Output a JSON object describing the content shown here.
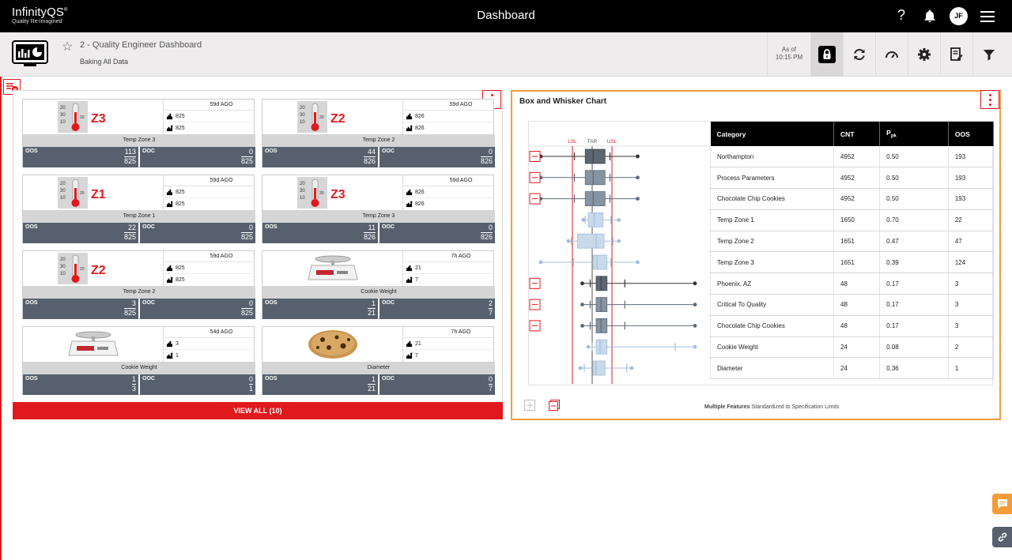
{
  "topbar": {
    "brand": "InfinityQS",
    "brand_reg": "®",
    "tagline": "Quality Re-imagined",
    "title": "Dashboard",
    "help": "?",
    "user_initials": "JF"
  },
  "subheader": {
    "dashboard_name": "2 - Quality Engineer Dashboard",
    "data_scope": "Baking All Data",
    "as_of_label": "As of",
    "as_of_time": "10:15 PM"
  },
  "cards": [
    {
      "zone": "Z3",
      "ago": "59d AGO",
      "count_a": "825",
      "count_b": "825",
      "name": "Temp Zone 3",
      "oos_label": "OOS",
      "oos_num": "113",
      "oos_den": "825",
      "ooc_label": "OOC",
      "ooc_num": "0",
      "ooc_den": "825"
    },
    {
      "zone": "Z2",
      "ago": "59d AGO",
      "count_a": "826",
      "count_b": "826",
      "name": "Temp Zone 2",
      "oos_label": "OOS",
      "oos_num": "44",
      "oos_den": "826",
      "ooc_label": "OOC",
      "ooc_num": "0",
      "ooc_den": "826"
    },
    {
      "zone": "Z1",
      "ago": "59d AGO",
      "count_a": "825",
      "count_b": "825",
      "name": "Temp Zone 1",
      "oos_label": "OOS",
      "oos_num": "22",
      "oos_den": "825",
      "ooc_label": "OOC",
      "ooc_num": "0",
      "ooc_den": "825"
    },
    {
      "zone": "Z3",
      "ago": "59d AGO",
      "count_a": "826",
      "count_b": "826",
      "name": "Temp Zone 3",
      "oos_label": "OOS",
      "oos_num": "11",
      "oos_den": "826",
      "ooc_label": "OOC",
      "ooc_num": "0",
      "ooc_den": "826"
    },
    {
      "zone": "Z2",
      "ago": "59d AGO",
      "count_a": "825",
      "count_b": "825",
      "name": "Temp Zone 2",
      "oos_label": "OOS",
      "oos_num": "3",
      "oos_den": "825",
      "ooc_label": "OOC",
      "ooc_num": "0",
      "ooc_den": "825"
    },
    {
      "zone": "",
      "ago": "7h AGO",
      "count_a": "21",
      "count_b": "7",
      "name": "Cookie Weight",
      "oos_label": "OOS",
      "oos_num": "1",
      "oos_den": "21",
      "ooc_label": "OOC",
      "ooc_num": "2",
      "ooc_den": "7"
    },
    {
      "zone": "",
      "ago": "54d AGO",
      "count_a": "3",
      "count_b": "1",
      "name": "Cookie Weight",
      "oos_label": "OOS",
      "oos_num": "1",
      "oos_den": "3",
      "ooc_label": "OOC",
      "ooc_num": "0",
      "ooc_den": "1"
    },
    {
      "zone": "",
      "ago": "7h AGO",
      "count_a": "21",
      "count_b": "7",
      "name": "Diameter",
      "oos_label": "OOS",
      "oos_num": "1",
      "oos_den": "21",
      "ooc_label": "OOC",
      "ooc_num": "0",
      "ooc_den": "7"
    }
  ],
  "view_all": "VIEW ALL (10)",
  "box_panel": {
    "title": "Box and Whisker Chart",
    "footer_bold": "Multiple Features",
    "footer_rest": " Standardized to Specification Limits",
    "limit_labels": {
      "lsl": "LSL",
      "tar": "TAR",
      "usl": "USL"
    },
    "x_ticks": [
      "-1.0",
      "0.0",
      "1.0"
    ],
    "columns": [
      "Category",
      "CNT",
      "Ppk",
      "OOS"
    ],
    "rows": [
      {
        "category": "Northampton",
        "cnt": "4952",
        "ppk": "0.50",
        "oos": "193"
      },
      {
        "category": "Process Parameters",
        "cnt": "4952",
        "ppk": "0.50",
        "oos": "193"
      },
      {
        "category": "Chocolate Chip Cookies",
        "cnt": "4952",
        "ppk": "0.50",
        "oos": "193"
      },
      {
        "category": "Temp Zone 1",
        "cnt": "1650",
        "ppk": "0.70",
        "oos": "22"
      },
      {
        "category": "Temp Zone 2",
        "cnt": "1651",
        "ppk": "0.47",
        "oos": "47"
      },
      {
        "category": "Temp Zone 3",
        "cnt": "1651",
        "ppk": "0.39",
        "oos": "124"
      },
      {
        "category": "Phoenix, AZ",
        "cnt": "48",
        "ppk": "0.17",
        "oos": "3"
      },
      {
        "category": "Critical To Quality",
        "cnt": "48",
        "ppk": "0.17",
        "oos": "3"
      },
      {
        "category": "Chocolate Chip Cookies",
        "cnt": "48",
        "ppk": "0.17",
        "oos": "3"
      },
      {
        "category": "Cookie Weight",
        "cnt": "24",
        "ppk": "0.08",
        "oos": "2"
      },
      {
        "category": "Diameter",
        "cnt": "24",
        "ppk": "0.36",
        "oos": "1"
      }
    ],
    "boxes": [
      {
        "min": -2.6,
        "q1": -0.35,
        "med": 0.05,
        "q3": 0.65,
        "max": 2.3,
        "tick_lo": -0.9,
        "tick_hi": 0.9,
        "collapsible": true,
        "tone": "dark"
      },
      {
        "min": -2.6,
        "q1": -0.35,
        "med": 0.05,
        "q3": 0.65,
        "max": 2.3,
        "tick_lo": -0.9,
        "tick_hi": 0.9,
        "collapsible": true,
        "tone": "mid"
      },
      {
        "min": -2.6,
        "q1": -0.35,
        "med": 0.05,
        "q3": 0.65,
        "max": 2.3,
        "tick_lo": -0.9,
        "tick_hi": 0.9,
        "collapsible": true,
        "tone": "mid"
      },
      {
        "min": -0.45,
        "q1": -0.2,
        "med": 0.1,
        "q3": 0.55,
        "max": 1.35,
        "tick_lo": -0.35,
        "tick_hi": 0.95,
        "collapsible": false,
        "tone": "light"
      },
      {
        "min": -1.2,
        "q1": -0.75,
        "med": 0.2,
        "q3": 0.6,
        "max": 1.35,
        "tick_lo": -1.05,
        "tick_hi": 1.05,
        "collapsible": false,
        "tone": "light"
      },
      {
        "min": -2.6,
        "q1": 0.05,
        "med": 0.25,
        "q3": 0.75,
        "max": 2.3,
        "tick_lo": -0.95,
        "tick_hi": 0.95,
        "collapsible": false,
        "tone": "light"
      },
      {
        "min": -0.5,
        "q1": 0.2,
        "med": 0.45,
        "q3": 0.75,
        "max": 5.2,
        "tick_lo": -0.1,
        "tick_hi": 1.65,
        "collapsible": true,
        "tone": "dark"
      },
      {
        "min": -0.5,
        "q1": 0.2,
        "med": 0.45,
        "q3": 0.75,
        "max": 5.2,
        "tick_lo": -0.1,
        "tick_hi": 1.65,
        "collapsible": true,
        "tone": "mid"
      },
      {
        "min": -0.5,
        "q1": 0.2,
        "med": 0.45,
        "q3": 0.75,
        "max": 5.2,
        "tick_lo": -0.1,
        "tick_hi": 1.65,
        "collapsible": true,
        "tone": "mid"
      },
      {
        "min": -0.2,
        "q1": 0.2,
        "med": 0.4,
        "q3": 0.75,
        "max": 5.2,
        "tick_lo": 0.0,
        "tick_hi": 4.2,
        "collapsible": false,
        "tone": "light"
      },
      {
        "min": -0.6,
        "q1": 0.05,
        "med": 0.2,
        "q3": 0.65,
        "max": 2.0,
        "tick_lo": -0.4,
        "tick_hi": 1.75,
        "collapsible": false,
        "tone": "light"
      }
    ]
  },
  "colors": {
    "accent": "#e1191d",
    "stat_bg": "#56616d",
    "highlight_border": "#f39c3a",
    "table_header": "#000000"
  }
}
